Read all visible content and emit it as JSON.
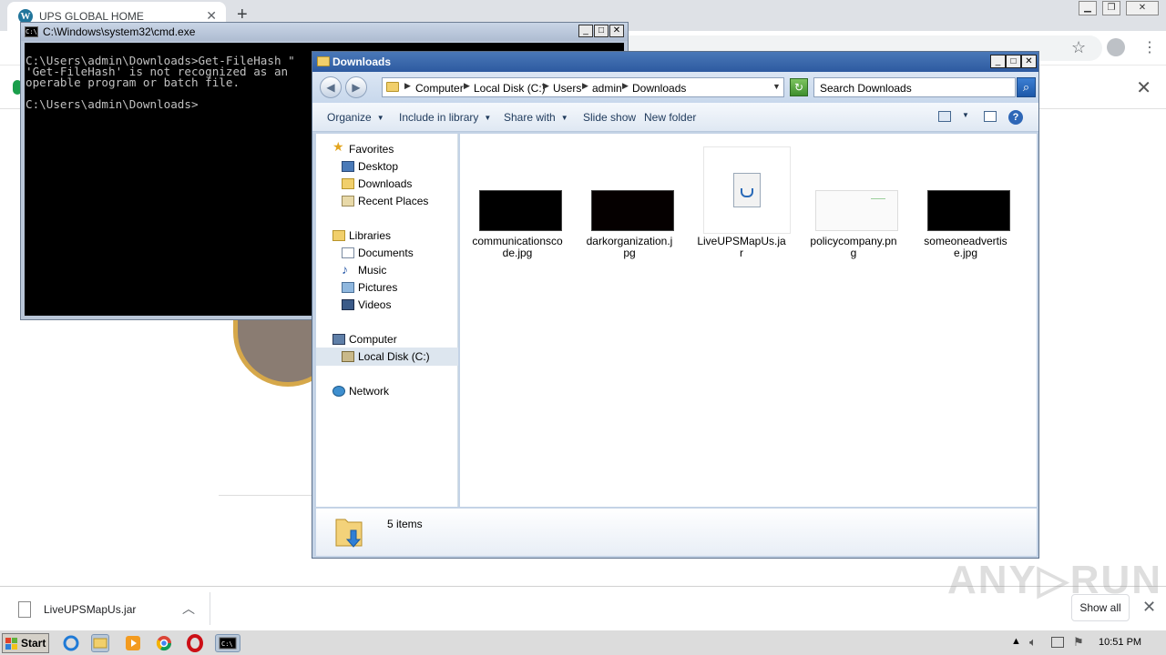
{
  "browser": {
    "tab_title": "UPS GLOBAL HOME",
    "new_tab": "+",
    "tab_close": "✕",
    "banner_close": "✕"
  },
  "download_bar": {
    "file_name": "LiveUPSMapUs.jar",
    "show_all": "Show all",
    "close": "✕"
  },
  "watermark": "ANY▷RUN",
  "cmd": {
    "title": "C:\\Windows\\system32\\cmd.exe",
    "lines": [
      "C:\\Users\\admin\\Downloads>Get-FileHash \"",
      "'Get-FileHash' is not recognized as an",
      "operable program or batch file.",
      "",
      "C:\\Users\\admin\\Downloads>"
    ]
  },
  "explorer": {
    "title": "Downloads",
    "breadcrumb": [
      "Computer",
      "Local Disk (C:)",
      "Users",
      "admin",
      "Downloads"
    ],
    "search_placeholder": "Search Downloads",
    "toolbar": {
      "organize": "Organize",
      "include_in_library": "Include in library",
      "share_with": "Share with",
      "slide_show": "Slide show",
      "new_folder": "New folder"
    },
    "nav": {
      "favorites": "Favorites",
      "desktop": "Desktop",
      "downloads": "Downloads",
      "recent_places": "Recent Places",
      "libraries": "Libraries",
      "documents": "Documents",
      "music": "Music",
      "pictures": "Pictures",
      "videos": "Videos",
      "computer": "Computer",
      "local_disk": "Local Disk (C:)",
      "network": "Network"
    },
    "files": [
      {
        "name": "communicationscode.jpg",
        "kind": "dark-image"
      },
      {
        "name": "darkorganization.jpg",
        "kind": "dark-image"
      },
      {
        "name": "LiveUPSMapUs.jar",
        "kind": "java-archive"
      },
      {
        "name": "policycompany.png",
        "kind": "light-image"
      },
      {
        "name": "someoneadvertise.jpg",
        "kind": "dark-image"
      }
    ],
    "status": "5 items"
  },
  "taskbar": {
    "start": "Start",
    "clock": "10:51 PM"
  }
}
